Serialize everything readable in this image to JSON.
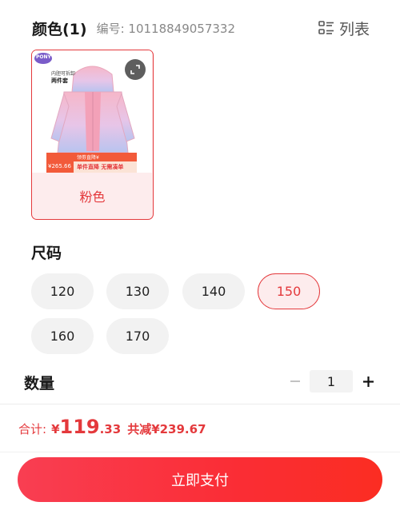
{
  "color_section": {
    "title": "颜色(1)",
    "code_label": "编号: 10118849057332",
    "list_toggle_label": "列表",
    "options": [
      {
        "label": "粉色",
        "selected": true,
        "image_text": {
          "brand": "PONY",
          "tag_line1": "内胆可拆卸",
          "tag_line2": "两件套",
          "banner_top": "领劵直降¥",
          "banner_price": "¥265.66",
          "banner_middle": "单件直降 无需凑单"
        }
      }
    ]
  },
  "size_section": {
    "title": "尺码",
    "options": [
      "120",
      "130",
      "140",
      "150",
      "160",
      "170"
    ],
    "selected": "150"
  },
  "quantity_section": {
    "title": "数量",
    "value": "1"
  },
  "summary": {
    "total_label": "合计:",
    "currency": "¥",
    "total_integer": "119",
    "total_decimal": ".33",
    "saved_label": "共减¥239.67"
  },
  "pay_button_label": "立即支付",
  "colors": {
    "accent": "#e4393c",
    "selected_bg": "#fdeced",
    "chip_bg": "#f2f2f2",
    "button_gradient_start": "#f93e52",
    "button_gradient_end": "#fb2d22"
  }
}
